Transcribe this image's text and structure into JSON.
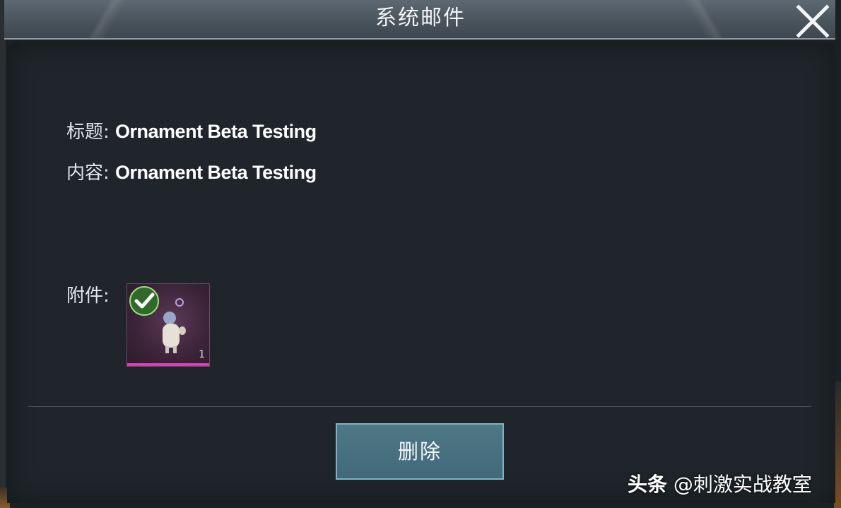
{
  "dialog": {
    "title": "系统邮件"
  },
  "mail": {
    "subject_label": "标题:",
    "subject_value": "Ornament Beta Testing",
    "content_label": "内容:",
    "content_value": "Ornament Beta Testing",
    "attachment_label": "附件:",
    "attachment": {
      "count": "1",
      "claimed": true,
      "rarity_color": "#d83fb6"
    }
  },
  "actions": {
    "delete_label": "删除"
  },
  "overlay": {
    "brand": "头条",
    "handle": "@刺激实战教室"
  },
  "colors": {
    "titlebar": "#4a545d",
    "panel": "#1f252a",
    "button": "#4e7886",
    "button_border": "#7fb3c4",
    "check": "#9be37c"
  }
}
